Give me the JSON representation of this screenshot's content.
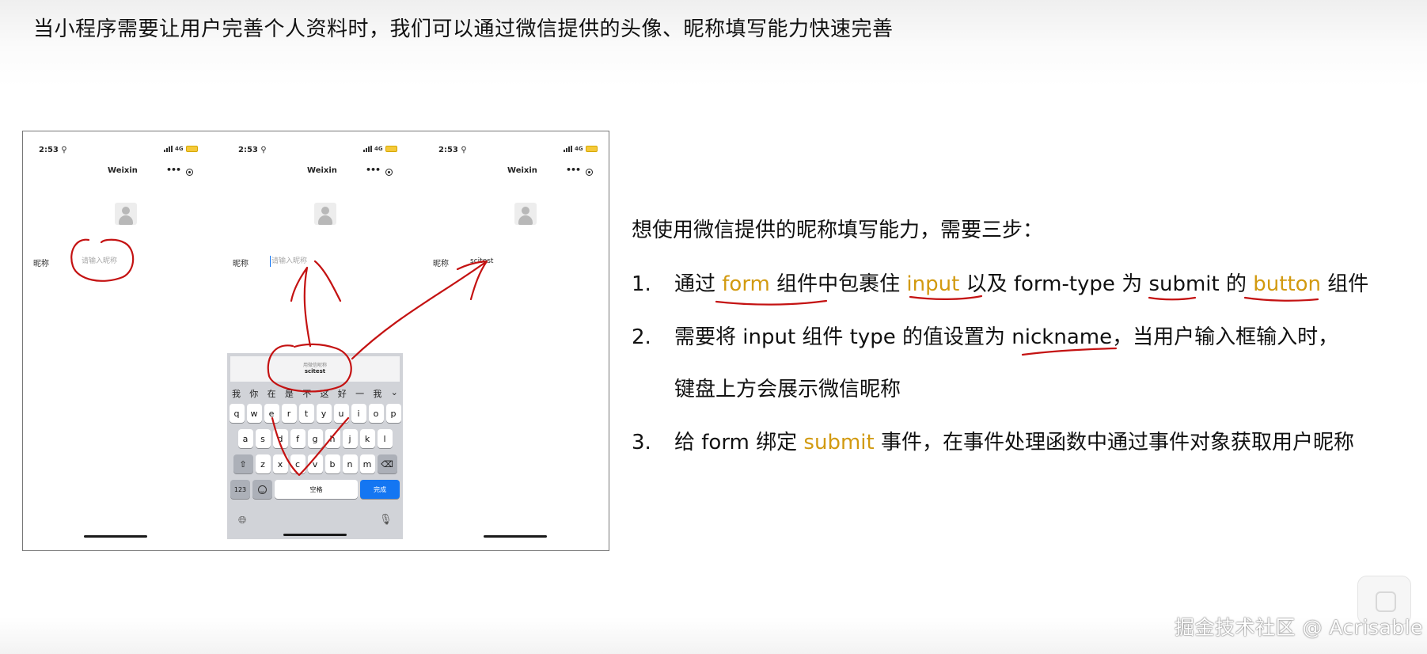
{
  "headline": "当小程序需要让用户完善个人资料时，我们可以通过微信提供的头像、昵称填写能力快速完善",
  "phones": [
    {
      "time": "2:53 ⚲",
      "network": "4G",
      "title": "Weixin",
      "nickname_label": "昵称",
      "nickname_placeholder": "请输入昵称",
      "nickname_value": ""
    },
    {
      "time": "2:53 ⚲",
      "network": "4G",
      "title": "Weixin",
      "nickname_label": "昵称",
      "nickname_placeholder": "请输入昵称",
      "nickname_value": ""
    },
    {
      "time": "2:53 ⚲",
      "network": "4G",
      "title": "Weixin",
      "nickname_label": "昵称",
      "nickname_placeholder": "",
      "nickname_value": "scitest"
    }
  ],
  "keyboard": {
    "suggest_caption": "用微信昵称",
    "suggest_value": "scitest",
    "candidates": [
      "我",
      "你",
      "在",
      "是",
      "不",
      "这",
      "好",
      "一",
      "我",
      "⌄"
    ],
    "row1": [
      "q",
      "w",
      "e",
      "r",
      "t",
      "y",
      "u",
      "i",
      "o",
      "p"
    ],
    "row2": [
      "a",
      "s",
      "d",
      "f",
      "g",
      "h",
      "j",
      "k",
      "l"
    ],
    "row3": [
      "z",
      "x",
      "c",
      "v",
      "b",
      "n",
      "m"
    ],
    "num_label": "123",
    "space_label": "空格",
    "done_label": "完成"
  },
  "subtitle": "想使用微信提供的昵称填写能力，需要三步：",
  "steps": {
    "s1": {
      "num": "1.",
      "a": "通过 ",
      "b": "form",
      "c": " 组件中包裹住 ",
      "d": "input",
      "e": " 以及 form-type 为 submit 的 ",
      "f": "button",
      "g": " 组件"
    },
    "s2": {
      "num": "2.",
      "a": "需要将 input 组件 type 的值设置为 nickname，当用户输入框输入时，",
      "b": "键盘上方会展示微信昵称"
    },
    "s3": {
      "num": "3.",
      "a": "给 form 绑定 ",
      "b": "submit",
      "c": " 事件，在事件处理函数中通过事件对象获取用户昵称"
    }
  },
  "watermark": "掘金技术社区 @ Acrisable",
  "colors": {
    "highlight": "#d29a10",
    "annotation": "#c41212",
    "done_key": "#1476f2"
  }
}
